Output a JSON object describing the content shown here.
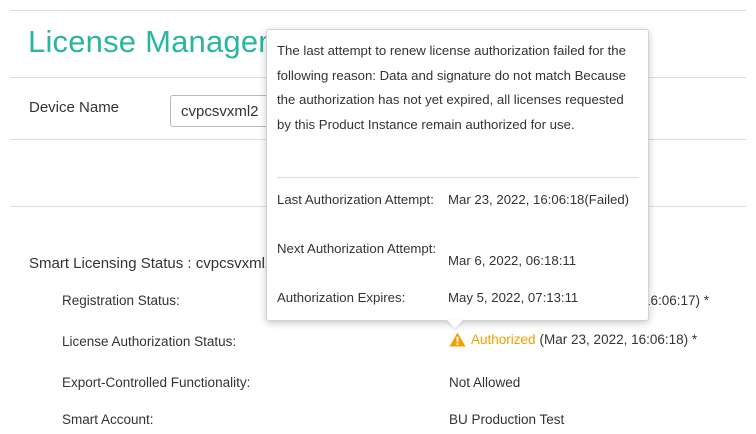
{
  "page": {
    "title": "License Management",
    "device_name_label": "Device Name",
    "device_name_value": "cvpcsvxml2"
  },
  "smart_licensing": {
    "heading": "Smart Licensing Status : cvpcsvxml2",
    "rows": [
      {
        "label": "Registration Status:",
        "value": "16:06:17) *"
      },
      {
        "label": "License Authorization Status:",
        "status": "Authorized",
        "detail": "(Mar 23, 2022, 16:06:18) *"
      },
      {
        "label": "Export-Controlled Functionality:",
        "value": "Not Allowed"
      },
      {
        "label": "Smart Account:",
        "value": "BU Production Test"
      }
    ]
  },
  "tooltip": {
    "message": "The last attempt to renew license authorization failed for the following reason: Data and signature do not match Because the authorization has not yet expired, all licenses requested by this Product Instance remain authorized for use.",
    "details": [
      {
        "label": "Last Authorization Attempt:",
        "value": "Mar 23, 2022, 16:06:18(Failed)"
      },
      {
        "label": "Next Authorization Attempt:",
        "value": "Mar 6, 2022, 06:18:11"
      },
      {
        "label": "Authorization Expires:",
        "value": "May 5, 2022, 07:13:11"
      }
    ]
  },
  "colors": {
    "title": "#29b6a0",
    "warning": "#f2a000"
  },
  "icons": {
    "authorization_status": "warning-triangle-icon"
  }
}
